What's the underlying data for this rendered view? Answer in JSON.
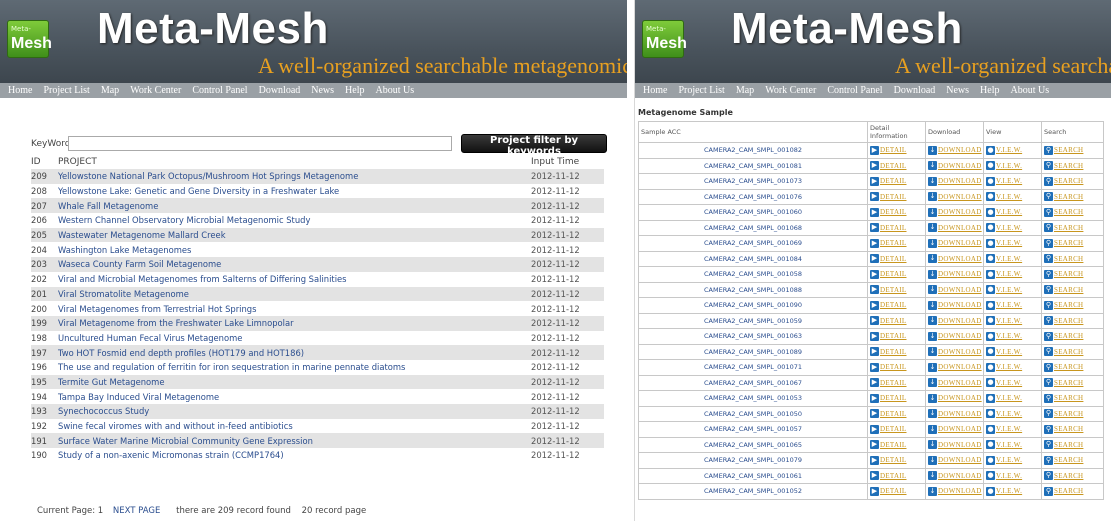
{
  "brand": {
    "logo_small": "Meta-",
    "logo_big": "Mesh",
    "title": "Meta-Mesh",
    "tagline": "A well-organized searchable metagenomic"
  },
  "nav": [
    "Home",
    "Project List",
    "Map",
    "Work Center",
    "Control Panel",
    "Download",
    "News",
    "Help",
    "About Us"
  ],
  "left": {
    "keyword_label": "KeyWord:",
    "keyword_value": "",
    "filter_button": "Project filter by keywords",
    "columns": {
      "id": "ID",
      "project": "PROJECT",
      "time": "Input Time"
    },
    "rows": [
      {
        "id": "209",
        "project": "Yellowstone National Park Octopus/Mushroom Hot Springs Metagenome",
        "time": "2012-11-12"
      },
      {
        "id": "208",
        "project": "Yellowstone Lake: Genetic and Gene Diversity in a Freshwater Lake",
        "time": "2012-11-12"
      },
      {
        "id": "207",
        "project": "Whale Fall Metagenome",
        "time": "2012-11-12"
      },
      {
        "id": "206",
        "project": "Western Channel Observatory Microbial Metagenomic Study",
        "time": "2012-11-12"
      },
      {
        "id": "205",
        "project": "Wastewater Metagenome Mallard Creek",
        "time": "2012-11-12"
      },
      {
        "id": "204",
        "project": "Washington Lake Metagenomes",
        "time": "2012-11-12"
      },
      {
        "id": "203",
        "project": "Waseca County Farm Soil Metagenome",
        "time": "2012-11-12"
      },
      {
        "id": "202",
        "project": "Viral and Microbial Metagenomes from Salterns of Differing Salinities",
        "time": "2012-11-12"
      },
      {
        "id": "201",
        "project": "Viral Stromatolite Metagenome",
        "time": "2012-11-12"
      },
      {
        "id": "200",
        "project": "Viral Metagenomes from Terrestrial Hot Springs",
        "time": "2012-11-12"
      },
      {
        "id": "199",
        "project": "Viral Metagenome from the Freshwater Lake Limnopolar",
        "time": "2012-11-12"
      },
      {
        "id": "198",
        "project": "Uncultured Human Fecal Virus Metagenome",
        "time": "2012-11-12"
      },
      {
        "id": "197",
        "project": "Two HOT Fosmid end depth profiles (HOT179 and HOT186)",
        "time": "2012-11-12"
      },
      {
        "id": "196",
        "project": "The use and regulation of ferritin for iron sequestration in marine pennate diatoms",
        "time": "2012-11-12"
      },
      {
        "id": "195",
        "project": "Termite Gut Metagenome",
        "time": "2012-11-12"
      },
      {
        "id": "194",
        "project": "Tampa Bay Induced Viral Metagenome",
        "time": "2012-11-12"
      },
      {
        "id": "193",
        "project": "Synechococcus Study",
        "time": "2012-11-12"
      },
      {
        "id": "192",
        "project": "Swine fecal viromes with and without in-feed antibiotics",
        "time": "2012-11-12"
      },
      {
        "id": "191",
        "project": "Surface Water Marine Microbial Community Gene Expression",
        "time": "2012-11-12"
      },
      {
        "id": "190",
        "project": "Study of a non-axenic Micromonas strain (CCMP1764)",
        "time": "2012-11-12"
      }
    ],
    "pager": {
      "current_label": "Current Page: 1",
      "next": "NEXT PAGE",
      "count": "there are 209 record found",
      "per_page": "20 record page"
    }
  },
  "right": {
    "section_title": "Metagenome Sample",
    "columns": {
      "acc": "Sample ACC",
      "detail": "Detail Information",
      "download": "Download",
      "view": "View",
      "search": "Search"
    },
    "actions": {
      "detail": "DETAIL",
      "download": "DOWNLOAD",
      "view": "V.I.E.W.",
      "search": "SEARCH"
    },
    "samples": [
      "CAMERA2_CAM_SMPL_001082",
      "CAMERA2_CAM_SMPL_001081",
      "CAMERA2_CAM_SMPL_001073",
      "CAMERA2_CAM_SMPL_001076",
      "CAMERA2_CAM_SMPL_001060",
      "CAMERA2_CAM_SMPL_001068",
      "CAMERA2_CAM_SMPL_001069",
      "CAMERA2_CAM_SMPL_001084",
      "CAMERA2_CAM_SMPL_001058",
      "CAMERA2_CAM_SMPL_001088",
      "CAMERA2_CAM_SMPL_001090",
      "CAMERA2_CAM_SMPL_001059",
      "CAMERA2_CAM_SMPL_001063",
      "CAMERA2_CAM_SMPL_001089",
      "CAMERA2_CAM_SMPL_001071",
      "CAMERA2_CAM_SMPL_001067",
      "CAMERA2_CAM_SMPL_001053",
      "CAMERA2_CAM_SMPL_001050",
      "CAMERA2_CAM_SMPL_001057",
      "CAMERA2_CAM_SMPL_001065",
      "CAMERA2_CAM_SMPL_001079",
      "CAMERA2_CAM_SMPL_001061",
      "CAMERA2_CAM_SMPL_001052"
    ]
  }
}
